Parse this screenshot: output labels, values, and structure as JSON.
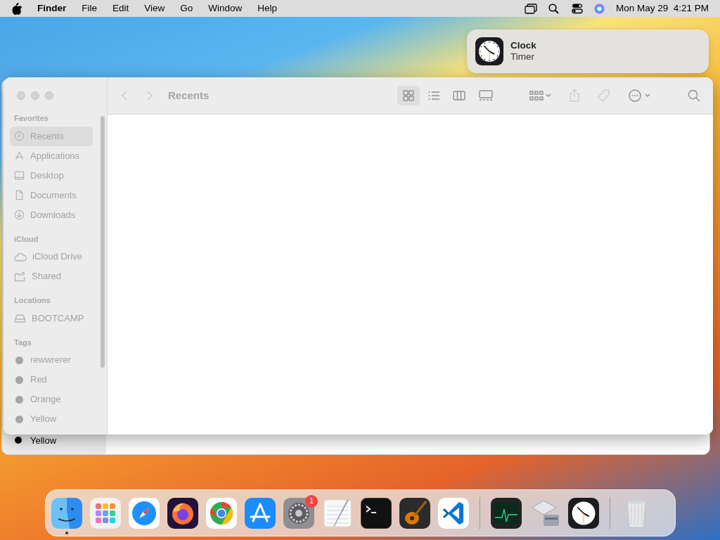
{
  "menu_bar": {
    "app": "Finder",
    "menus": [
      "File",
      "Edit",
      "View",
      "Go",
      "Window",
      "Help"
    ],
    "clock": "Mon May 29  4:21 PM"
  },
  "notification": {
    "app": "Clock",
    "message": "Timer"
  },
  "background_window": {
    "tag": {
      "label": "Yellow",
      "color": "#000000"
    }
  },
  "finder": {
    "title": "Recents",
    "back_disabled": true,
    "forward_disabled": true,
    "view_modes": [
      {
        "kind": "icons",
        "selected": true
      },
      {
        "kind": "list",
        "selected": false
      },
      {
        "kind": "columns",
        "selected": false
      },
      {
        "kind": "gallery",
        "selected": false
      }
    ],
    "sidebar": [
      {
        "heading": "Favorites",
        "items": [
          {
            "kind": "recents",
            "label": "Recents",
            "selected": true
          },
          {
            "kind": "applications",
            "label": "Applications",
            "selected": false
          },
          {
            "kind": "desktop",
            "label": "Desktop",
            "selected": false
          },
          {
            "kind": "documents",
            "label": "Documents",
            "selected": false
          },
          {
            "kind": "downloads",
            "label": "Downloads",
            "selected": false
          }
        ]
      },
      {
        "heading": "iCloud",
        "items": [
          {
            "kind": "cloud",
            "label": "iCloud Drive",
            "selected": false
          },
          {
            "kind": "shared",
            "label": "Shared",
            "selected": false
          }
        ]
      },
      {
        "heading": "Locations",
        "items": [
          {
            "kind": "drive",
            "label": "BOOTCAMP",
            "selected": false
          }
        ]
      },
      {
        "heading": "Tags",
        "items": [
          {
            "kind": "tag",
            "label": "rewwrerer",
            "selected": false
          },
          {
            "kind": "tag",
            "label": "Red",
            "selected": false
          },
          {
            "kind": "tag",
            "label": "Orange",
            "selected": false
          },
          {
            "kind": "tag",
            "label": "Yellow",
            "selected": false
          }
        ]
      }
    ]
  },
  "dock": [
    {
      "kind": "finder",
      "running": true
    },
    {
      "kind": "launchpad",
      "running": false
    },
    {
      "kind": "safari",
      "running": false
    },
    {
      "kind": "firefox",
      "running": false
    },
    {
      "kind": "chrome",
      "running": false
    },
    {
      "kind": "appstore",
      "running": false
    },
    {
      "kind": "settings",
      "running": false,
      "badge": "1"
    },
    {
      "kind": "textedit",
      "running": false
    },
    {
      "kind": "terminal",
      "running": false
    },
    {
      "kind": "garageband",
      "running": false
    },
    {
      "kind": "vscode",
      "running": false
    },
    {
      "kind": "separator"
    },
    {
      "kind": "monitor",
      "running": false
    },
    {
      "kind": "bootcamp",
      "running": false
    },
    {
      "kind": "clock",
      "running": false
    },
    {
      "kind": "separator"
    },
    {
      "kind": "trash",
      "running": false
    }
  ]
}
